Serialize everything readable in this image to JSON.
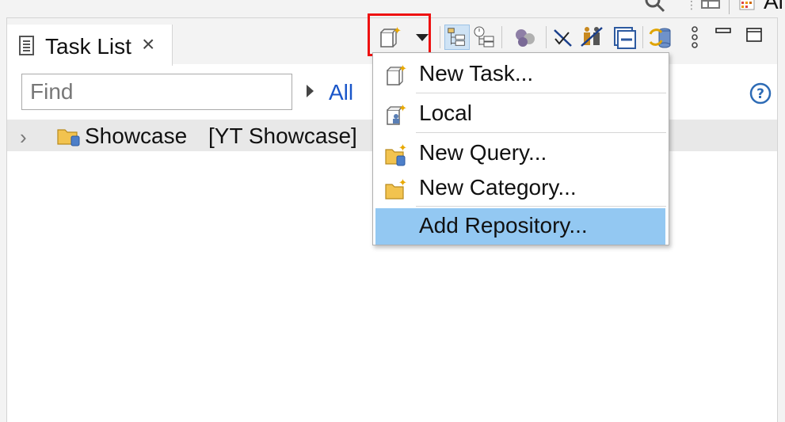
{
  "top_strip": {
    "app_label": "Al",
    "icons": [
      "search-icon",
      "open-perspective-icon",
      "app-icon"
    ]
  },
  "view": {
    "tab": {
      "title": "Task List",
      "icon": "task-list-icon",
      "close_icon": "close-icon"
    },
    "toolbar": {
      "buttons": [
        "new-task-icon",
        "dropdown-arrow-icon",
        "categorized-icon",
        "scheduled-icon",
        "focus-icon",
        "hide-completed-icon",
        "presentation-icon",
        "collapse-all-icon",
        "synchronize-icon",
        "view-menu-icon",
        "minimize-icon",
        "maximize-icon"
      ]
    },
    "filter": {
      "find_placeholder": "Find",
      "find_value": "",
      "all_label": "All",
      "help_icon": "help-icon"
    },
    "tree": [
      {
        "name": "Showcase",
        "repository": "[YT Showcase]",
        "icon": "query-folder-icon",
        "expanded": false
      }
    ]
  },
  "menu": {
    "items": [
      {
        "label": "New Task...",
        "icon": "new-task-icon",
        "selected": false
      },
      {
        "label": "Local",
        "icon": "local-task-icon",
        "selected": false
      },
      {
        "label": "New Query...",
        "icon": "new-query-icon",
        "selected": false
      },
      {
        "label": "New Category...",
        "icon": "new-category-icon",
        "selected": false
      },
      {
        "label": "Add Repository...",
        "icon": "",
        "selected": true
      }
    ]
  },
  "colors": {
    "selection": "#93c8f2",
    "link": "#1a56c9",
    "highlight_box": "#e11111"
  }
}
